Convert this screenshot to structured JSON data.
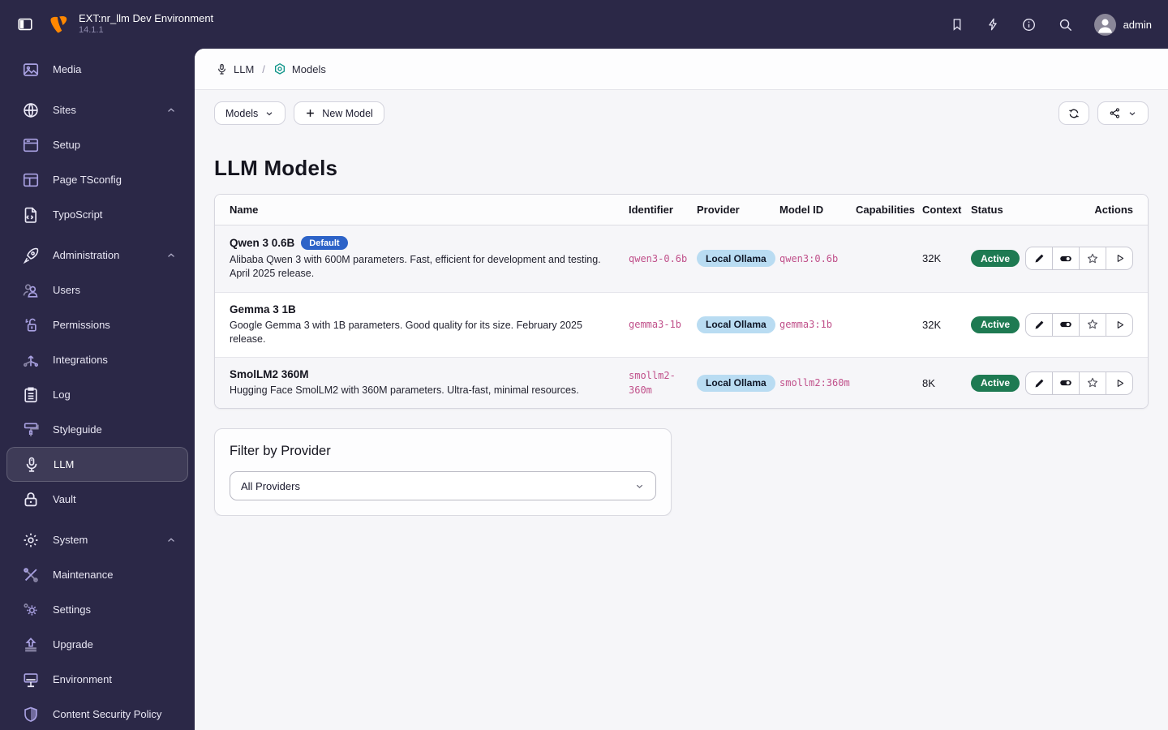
{
  "topbar": {
    "title": "EXT:nr_llm Dev Environment",
    "version": "14.1.1",
    "user": "admin"
  },
  "sidebar": {
    "items": [
      {
        "label": "Media"
      },
      {
        "label": "Sites"
      },
      {
        "label": "Setup"
      },
      {
        "label": "Page TSconfig"
      },
      {
        "label": "TypoScript"
      },
      {
        "label": "Administration"
      },
      {
        "label": "Users"
      },
      {
        "label": "Permissions"
      },
      {
        "label": "Integrations"
      },
      {
        "label": "Log"
      },
      {
        "label": "Styleguide"
      },
      {
        "label": "LLM"
      },
      {
        "label": "Vault"
      },
      {
        "label": "System"
      },
      {
        "label": "Maintenance"
      },
      {
        "label": "Settings"
      },
      {
        "label": "Upgrade"
      },
      {
        "label": "Environment"
      },
      {
        "label": "Content Security Policy"
      }
    ]
  },
  "breadcrumb": {
    "module": "LLM",
    "separator": "/",
    "page": "Models"
  },
  "docheader": {
    "dropdown_label": "Models",
    "new_button": "New Model"
  },
  "page": {
    "heading": "LLM Models"
  },
  "models_table": {
    "columns": [
      "Name",
      "Identifier",
      "Provider",
      "Model ID",
      "Capabilities",
      "Context",
      "Status",
      "Actions"
    ],
    "rows": [
      {
        "name": "Qwen 3 0.6B",
        "badge": "Default",
        "description": "Alibaba Qwen 3 with 600M parameters. Fast, efficient for development and testing. April 2025 release.",
        "identifier": "qwen3-0.6b",
        "provider": "Local Ollama",
        "model_id": "qwen3:0.6b",
        "capabilities": "",
        "context": "32K",
        "status": "Active"
      },
      {
        "name": "Gemma 3 1B",
        "description": "Google Gemma 3 with 1B parameters. Good quality for its size. February 2025 release.",
        "identifier": "gemma3-1b",
        "provider": "Local Ollama",
        "model_id": "gemma3:1b",
        "capabilities": "",
        "context": "32K",
        "status": "Active"
      },
      {
        "name": "SmolLM2 360M",
        "description": "Hugging Face SmolLM2 with 360M parameters. Ultra-fast, minimal resources.",
        "identifier": "smollm2-360m",
        "provider": "Local Ollama",
        "model_id": "smollm2:360m",
        "capabilities": "",
        "context": "8K",
        "status": "Active"
      }
    ]
  },
  "filter_panel": {
    "heading": "Filter by Provider",
    "selected_option": "All Providers"
  },
  "colors": {
    "sidebar_bg": "#2b2847",
    "brand_orange": "#ff8700",
    "models_teal": "#0d9488",
    "default_badge_blue": "#2d63c8",
    "provider_badge_blue": "#b9dcf2",
    "status_green": "#1e7a52",
    "code_pink": "#c0508a"
  }
}
